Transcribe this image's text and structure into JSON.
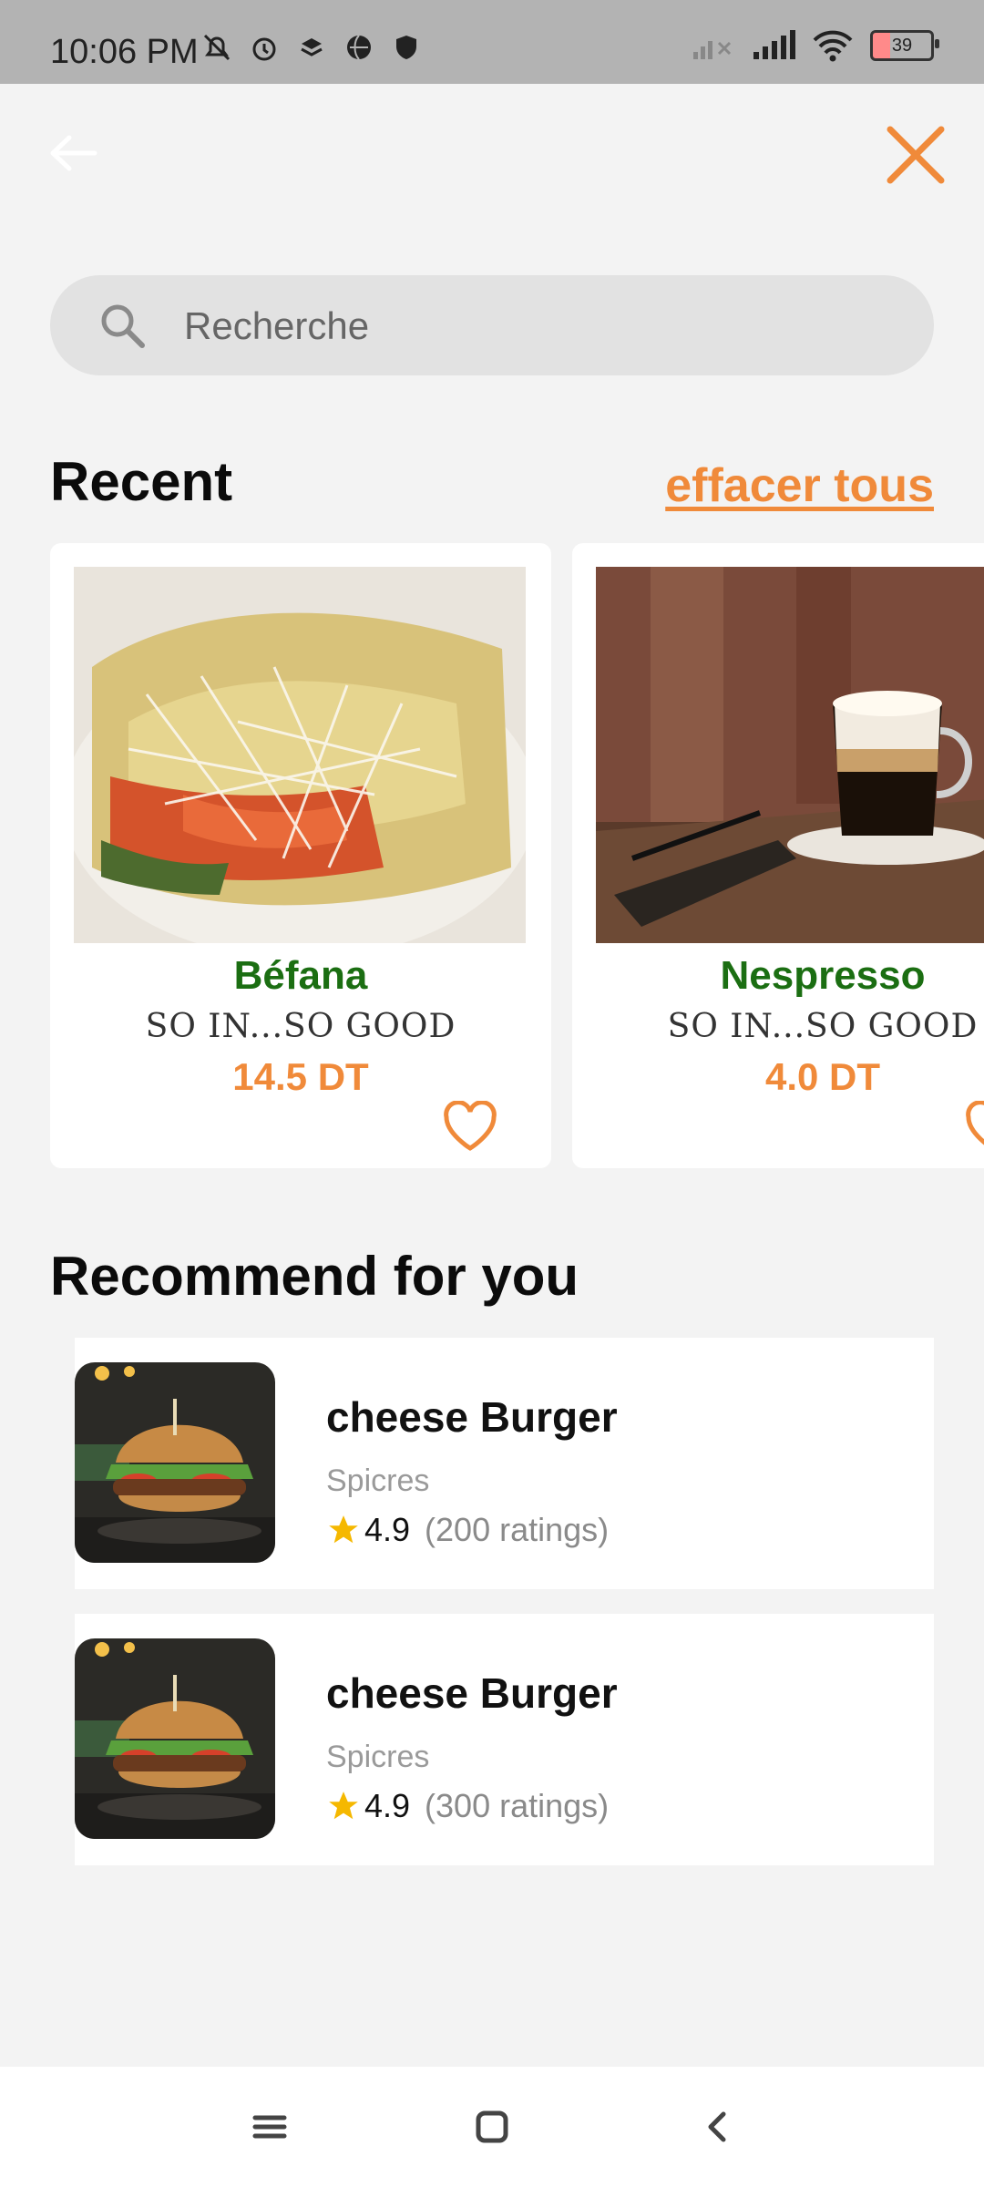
{
  "status_bar": {
    "time": "10:06 PM",
    "battery": "39",
    "icons_left": [
      "muted-alarm-icon",
      "alarm-icon",
      "stack-icon",
      "browser-icon",
      "shield-icon"
    ],
    "icons_right": [
      "signal-off-icon",
      "signal-icon",
      "wifi-icon",
      "battery-icon"
    ]
  },
  "header": {
    "back_icon": "back-arrow-icon",
    "close_icon": "close-icon",
    "accent_color": "#f08a3a"
  },
  "search": {
    "placeholder": "Recherche",
    "value": ""
  },
  "recent": {
    "title": "Recent",
    "clear_all": "effacer tous",
    "items": [
      {
        "name": "Béfana",
        "slogan": "SO IN...SO GOOD",
        "price": "14.5 DT",
        "image": "omelette-photo"
      },
      {
        "name": "Nespresso",
        "slogan": "SO IN...SO GOOD",
        "price": "4.0 DT",
        "image": "coffee-photo"
      }
    ]
  },
  "recommend": {
    "title": "Recommend for you",
    "items": [
      {
        "title": "cheese Burger",
        "subtitle": "Spicres",
        "score": "4.9",
        "ratings": "(200 ratings)",
        "image": "burger-photo"
      },
      {
        "title": "cheese Burger",
        "subtitle": "Spicres",
        "score": "4.9",
        "ratings": "(300 ratings)",
        "image": "burger-photo"
      }
    ]
  },
  "nav": {
    "buttons": [
      "menu-icon",
      "home-icon",
      "back-icon"
    ]
  }
}
